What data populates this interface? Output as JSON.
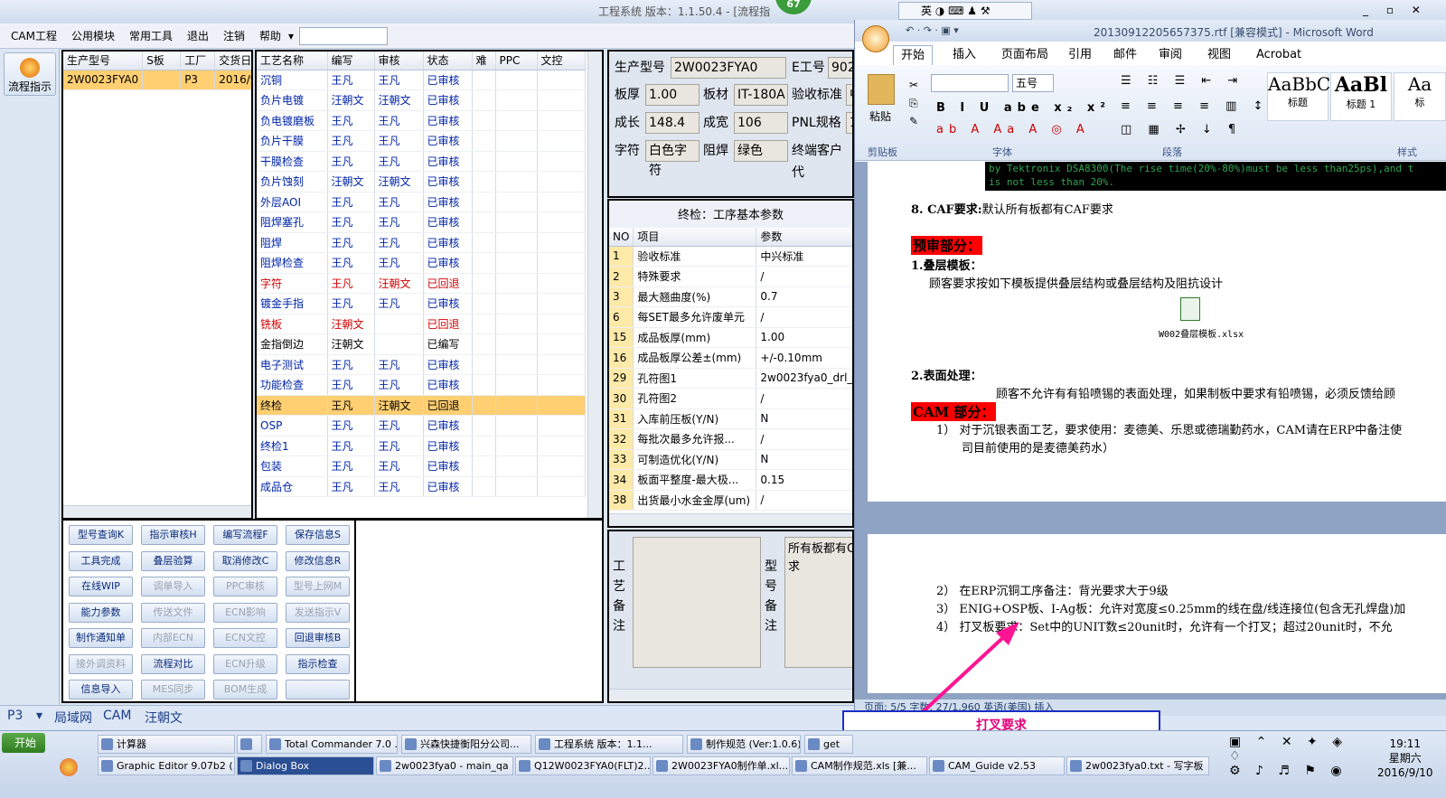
{
  "app": {
    "title": "工程系统  版本：1.1.50.4 - [流程指",
    "notif_badge": "67"
  },
  "menu": [
    "CAM工程",
    "公用模块",
    "常用工具",
    "退出",
    "注销",
    "帮助"
  ],
  "side": {
    "flow_button": "流程指示"
  },
  "list1": {
    "headers": [
      "生产型号",
      "S板",
      "工厂",
      "交货日期"
    ],
    "rows": [
      [
        "2W0023FYA0",
        "",
        "P3",
        "2016/9/"
      ]
    ]
  },
  "process": {
    "headers": [
      "工艺名称",
      "编写",
      "审核",
      "状态",
      "难",
      "PPC",
      "文控"
    ],
    "rows": [
      {
        "name": "沉铜",
        "writer": "王凡",
        "reviewer": "王凡",
        "status": "已审核",
        "style": "blue"
      },
      {
        "name": "负片电镀",
        "writer": "汪朝文",
        "reviewer": "汪朝文",
        "status": "已审核",
        "style": "blue"
      },
      {
        "name": "负电镀磨板",
        "writer": "王凡",
        "reviewer": "王凡",
        "status": "已审核",
        "style": "blue"
      },
      {
        "name": "负片干膜",
        "writer": "王凡",
        "reviewer": "王凡",
        "status": "已审核",
        "style": "blue"
      },
      {
        "name": "干膜检查",
        "writer": "王凡",
        "reviewer": "王凡",
        "status": "已审核",
        "style": "blue"
      },
      {
        "name": "负片蚀刻",
        "writer": "汪朝文",
        "reviewer": "汪朝文",
        "status": "已审核",
        "style": "blue"
      },
      {
        "name": "外层AOI",
        "writer": "王凡",
        "reviewer": "王凡",
        "status": "已审核",
        "style": "blue"
      },
      {
        "name": "阻焊塞孔",
        "writer": "王凡",
        "reviewer": "王凡",
        "status": "已审核",
        "style": "blue"
      },
      {
        "name": "阻焊",
        "writer": "王凡",
        "reviewer": "王凡",
        "status": "已审核",
        "style": "blue"
      },
      {
        "name": "阻焊检查",
        "writer": "王凡",
        "reviewer": "王凡",
        "status": "已审核",
        "style": "blue"
      },
      {
        "name": "字符",
        "writer": "王凡",
        "reviewer": "汪朝文",
        "status": "已回退",
        "style": "red"
      },
      {
        "name": "镀金手指",
        "writer": "王凡",
        "reviewer": "王凡",
        "status": "已审核",
        "style": "blue"
      },
      {
        "name": "铣板",
        "writer": "汪朝文",
        "reviewer": "",
        "status": "已回退",
        "style": "red"
      },
      {
        "name": "金指倒边",
        "writer": "汪朝文",
        "reviewer": "",
        "status": "已编写",
        "style": "black"
      },
      {
        "name": "电子测试",
        "writer": "王凡",
        "reviewer": "王凡",
        "status": "已审核",
        "style": "blue"
      },
      {
        "name": "功能检查",
        "writer": "王凡",
        "reviewer": "王凡",
        "status": "已审核",
        "style": "blue"
      },
      {
        "name": "终检",
        "writer": "王凡",
        "reviewer": "汪朝文",
        "status": "已回退",
        "style": "sel"
      },
      {
        "name": "OSP",
        "writer": "王凡",
        "reviewer": "王凡",
        "status": "已审核",
        "style": "blue"
      },
      {
        "name": "终检1",
        "writer": "王凡",
        "reviewer": "王凡",
        "status": "已审核",
        "style": "blue"
      },
      {
        "name": "包装",
        "writer": "王凡",
        "reviewer": "王凡",
        "status": "已审核",
        "style": "blue"
      },
      {
        "name": "成品仓",
        "writer": "王凡",
        "reviewer": "王凡",
        "status": "已审核",
        "style": "blue"
      }
    ]
  },
  "info": {
    "model_label": "生产型号",
    "model": "2W0023FYA0",
    "e_label": "E工号",
    "e_value": "902",
    "thick_label": "板厚",
    "thick": "1.00",
    "mat_label": "板材",
    "mat": "IT-180A",
    "std_label": "验收标准",
    "std": "中",
    "len_label": "成长",
    "len": "148.4",
    "wid_label": "成宽",
    "wid": "106",
    "pnl_label": "PNL规格",
    "pnl": "1",
    "char_label": "字符",
    "char": "白色字符",
    "mask_label": "阻焊",
    "mask": "绿色",
    "cust_label": "终端客户代"
  },
  "params": {
    "title": "终检：工序基本参数",
    "headers": [
      "NO",
      "项目",
      "参数"
    ],
    "rows": [
      [
        "1",
        "验收标准",
        "中兴标准"
      ],
      [
        "2",
        "特殊要求",
        "/"
      ],
      [
        "3",
        "最大翘曲度(%)",
        "0.7"
      ],
      [
        "6",
        "每SET最多允许废单元",
        "/"
      ],
      [
        "15",
        "成品板厚(mm)",
        "1.00"
      ],
      [
        "16",
        "成品板厚公差±(mm)",
        "+/-0.10mm"
      ],
      [
        "29",
        "孔符图1",
        "2w0023fya0_drl_"
      ],
      [
        "30",
        "孔符图2",
        "/"
      ],
      [
        "31",
        "入库前压板(Y/N)",
        "N"
      ],
      [
        "32",
        "每批次最多允许报...",
        "/"
      ],
      [
        "33",
        "可制造优化(Y/N)",
        "N"
      ],
      [
        "34",
        "板面平整度-最大极...",
        "0.15"
      ],
      [
        "38",
        "出货最小水金金厚(um)",
        "/"
      ]
    ]
  },
  "buttons": [
    [
      "型号查询K",
      "指示审核H",
      "编写流程F",
      "保存信息S"
    ],
    [
      "工具完成",
      "叠层验算",
      "取消修改C",
      "修改信息R"
    ],
    [
      "在线WIP",
      "调单导入",
      "PPC审核",
      "型号上网M"
    ],
    [
      "能力参数",
      "传送文件",
      "ECN影响",
      "发送指示V"
    ],
    [
      "制作通知单",
      "内部ECN",
      "ECN文控",
      "回退审核B"
    ],
    [
      "接外调资料",
      "流程对比",
      "ECN升级",
      "指示检查"
    ],
    [
      "信息导入",
      "MES同步",
      "BOM生成",
      ""
    ]
  ],
  "remarks": {
    "process_label": "工艺备注",
    "model_label": "型号备注",
    "model_text": "所有板都有C求"
  },
  "status_bar": {
    "factory": "P3",
    "net": "局域网",
    "mode": "CAM",
    "user": "汪朝文"
  },
  "word": {
    "title": "20130912205657375.rtf [兼容模式] - Microsoft Word",
    "tabs": [
      "开始",
      "插入",
      "页面布局",
      "引用",
      "邮件",
      "审阅",
      "视图",
      "Acrobat"
    ],
    "groups": [
      "剪贴板",
      "字体",
      "段落",
      "样式"
    ],
    "font_size": "五号",
    "paste": "粘贴",
    "styles": [
      {
        "sample": "AaBbC",
        "name": "标题"
      },
      {
        "sample": "AaBl",
        "name": "标题 1"
      },
      {
        "sample": "Aa",
        "name": "标"
      }
    ],
    "code_line1": "by Tektronix DSA8300(The rise time(20%-80%)must be less than25ps),and t",
    "code_line2": "is not less than 20%.",
    "caf_num": "8. CAF要求:",
    "caf_text": "默认所有板都有CAF要求",
    "pre_review": "预审部分：",
    "stack_title": "1.叠层模板：",
    "stack_text": "顾客要求按如下模板提供叠层结构或叠层结构及阻抗设计",
    "file_name": "W002叠层模板.xlsx",
    "surface_title": "2.表面处理：",
    "surface_text": "顾客不允许有有铅喷锡的表面处理，如果制板中要求有铅喷锡，必须反馈给顾",
    "cam_title": "CAM 部分：",
    "cam_1": "1） 对于沉银表面工艺，要求使用：麦德美、乐思或德瑞勤药水，CAM请在ERP中备注使",
    "cam_1b": "司目前使用的是麦德美药水）",
    "cam_2": "2） 在ERP沉铜工序备注：背光要求大于9级",
    "cam_3": "3） ENIG+OSP板、I-Ag板：允许对宽度≤0.25mm的线在盘/线连接位(包含无孔焊盘)加",
    "cam_4": "4） 打叉板要求：Set中的UNIT数≤20unit时，允许有一个打叉；超过20unit时，不允",
    "status": "页面: 5/5  字数: 27/1,960  英语(美国)  插入"
  },
  "annotation": {
    "text": "打叉要求"
  },
  "taskbar": {
    "start": "开始",
    "row1": [
      "计算器",
      "",
      "Total Commander 7.0 ...",
      "兴森快捷衡阳分公司...",
      "工程系统  版本：1.1...",
      "制作规范 (Ver:1.0.6)",
      "get"
    ],
    "row2": [
      "Graphic Editor 9.07b2 (...",
      "Dialog Box",
      "2w0023fya0 - main_qa",
      "Q12W0023FYA0(FLT)2...",
      "2W0023FYA0制作单.xl...",
      "CAM制作规范.xls [兼...",
      "CAM_Guide v2.53",
      "2w0023fya0.txt - 写字板"
    ],
    "time": "19:11",
    "day": "星期六",
    "date": "2016/9/10",
    "ime": "英"
  },
  "colors": {
    "selected_row": "#ffcf72",
    "blue_text": "#0024a8",
    "red_text": "#d00000",
    "arrow": "#ff1493",
    "highlight_red": "#ff0000"
  }
}
